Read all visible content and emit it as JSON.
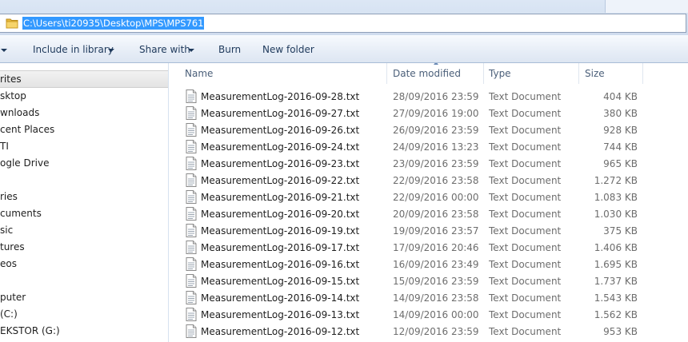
{
  "address_bar": {
    "path": "C:\\Users\\ti20935\\Desktop\\MPS\\MPS761"
  },
  "toolbar": {
    "include_in_library": "Include in library",
    "share_with": "Share with",
    "burn": "Burn",
    "new_folder": "New folder"
  },
  "nav_pane": {
    "items": [
      "rites",
      "sktop",
      "wnloads",
      "cent Places",
      "TI",
      "ogle Drive",
      "ries",
      "cuments",
      "sic",
      "tures",
      "eos",
      "puter",
      "(C:)",
      "EKSTOR (G:)"
    ]
  },
  "columns": {
    "name": "Name",
    "date": "Date modified",
    "type": "Type",
    "size": "Size"
  },
  "files": [
    {
      "name": "MeasurementLog-2016-09-28.txt",
      "date": "28/09/2016 23:59",
      "type": "Text Document",
      "size": "404 KB"
    },
    {
      "name": "MeasurementLog-2016-09-27.txt",
      "date": "27/09/2016 19:00",
      "type": "Text Document",
      "size": "380 KB"
    },
    {
      "name": "MeasurementLog-2016-09-26.txt",
      "date": "26/09/2016 23:59",
      "type": "Text Document",
      "size": "928 KB"
    },
    {
      "name": "MeasurementLog-2016-09-24.txt",
      "date": "24/09/2016 13:23",
      "type": "Text Document",
      "size": "744 KB"
    },
    {
      "name": "MeasurementLog-2016-09-23.txt",
      "date": "23/09/2016 23:59",
      "type": "Text Document",
      "size": "965 KB"
    },
    {
      "name": "MeasurementLog-2016-09-22.txt",
      "date": "22/09/2016 23:58",
      "type": "Text Document",
      "size": "1.272 KB"
    },
    {
      "name": "MeasurementLog-2016-09-21.txt",
      "date": "22/09/2016 00:00",
      "type": "Text Document",
      "size": "1.083 KB"
    },
    {
      "name": "MeasurementLog-2016-09-20.txt",
      "date": "20/09/2016 23:58",
      "type": "Text Document",
      "size": "1.030 KB"
    },
    {
      "name": "MeasurementLog-2016-09-19.txt",
      "date": "19/09/2016 23:57",
      "type": "Text Document",
      "size": "375 KB"
    },
    {
      "name": "MeasurementLog-2016-09-17.txt",
      "date": "17/09/2016 20:46",
      "type": "Text Document",
      "size": "1.406 KB"
    },
    {
      "name": "MeasurementLog-2016-09-16.txt",
      "date": "16/09/2016 23:49",
      "type": "Text Document",
      "size": "1.695 KB"
    },
    {
      "name": "MeasurementLog-2016-09-15.txt",
      "date": "15/09/2016 23:59",
      "type": "Text Document",
      "size": "1.737 KB"
    },
    {
      "name": "MeasurementLog-2016-09-14.txt",
      "date": "14/09/2016 23:58",
      "type": "Text Document",
      "size": "1.543 KB"
    },
    {
      "name": "MeasurementLog-2016-09-13.txt",
      "date": "14/09/2016 00:00",
      "type": "Text Document",
      "size": "1.562 KB"
    },
    {
      "name": "MeasurementLog-2016-09-12.txt",
      "date": "12/09/2016 23:59",
      "type": "Text Document",
      "size": "953 KB"
    }
  ],
  "colors": {
    "selection": "#3399ff",
    "toolbar_text": "#1e395b",
    "header_text": "#4c607a",
    "secondary_text": "#6d6d6d"
  },
  "icons": {
    "address_folder": "folder-icon",
    "file": "text-file-icon",
    "sort": "sort-arrow-icon"
  }
}
